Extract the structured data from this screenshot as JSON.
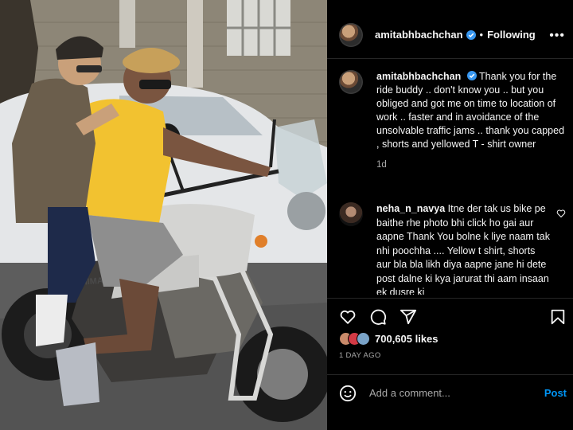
{
  "post": {
    "username": "amitabhbachchan",
    "separator": "•",
    "follow_status": "Following",
    "more": "•••",
    "caption_username": "amitabhbachchan",
    "caption_text": "Thank you for the ride buddy .. don't know you .. but you obliged and got me on time to location of work .. faster and in avoidance of the unsolvable traffic jams .. thank you capped , shorts and yellowed T - shirt owner",
    "caption_time": "1d"
  },
  "comment": {
    "username": "neha_n_navya",
    "text": "Itne der tak us bike pe baithe rhe photo bhi click ho gai aur aapne Thank You bolne k liye naam tak nhi poochha .... Yellow t shirt, shorts aur bla bla likh diya aapne jane hi dete post dalne ki kya jarurat thi aam insaan ek dusre ki"
  },
  "engagement": {
    "likes": "700,605 likes",
    "time_ago": "1 DAY AGO"
  },
  "composer": {
    "placeholder": "Add a comment...",
    "post_label": "Post"
  },
  "photo": {
    "bike_brand": "HIMALAYAN"
  },
  "icons": [
    "heart-icon",
    "comment-icon",
    "share-icon",
    "bookmark-icon",
    "emoji-icon",
    "verified-icon",
    "more-icon"
  ],
  "colors": {
    "accent": "#0095f6",
    "verified": "#3897f0",
    "muted": "#a8a8a8",
    "shirt": "#f2c230"
  }
}
